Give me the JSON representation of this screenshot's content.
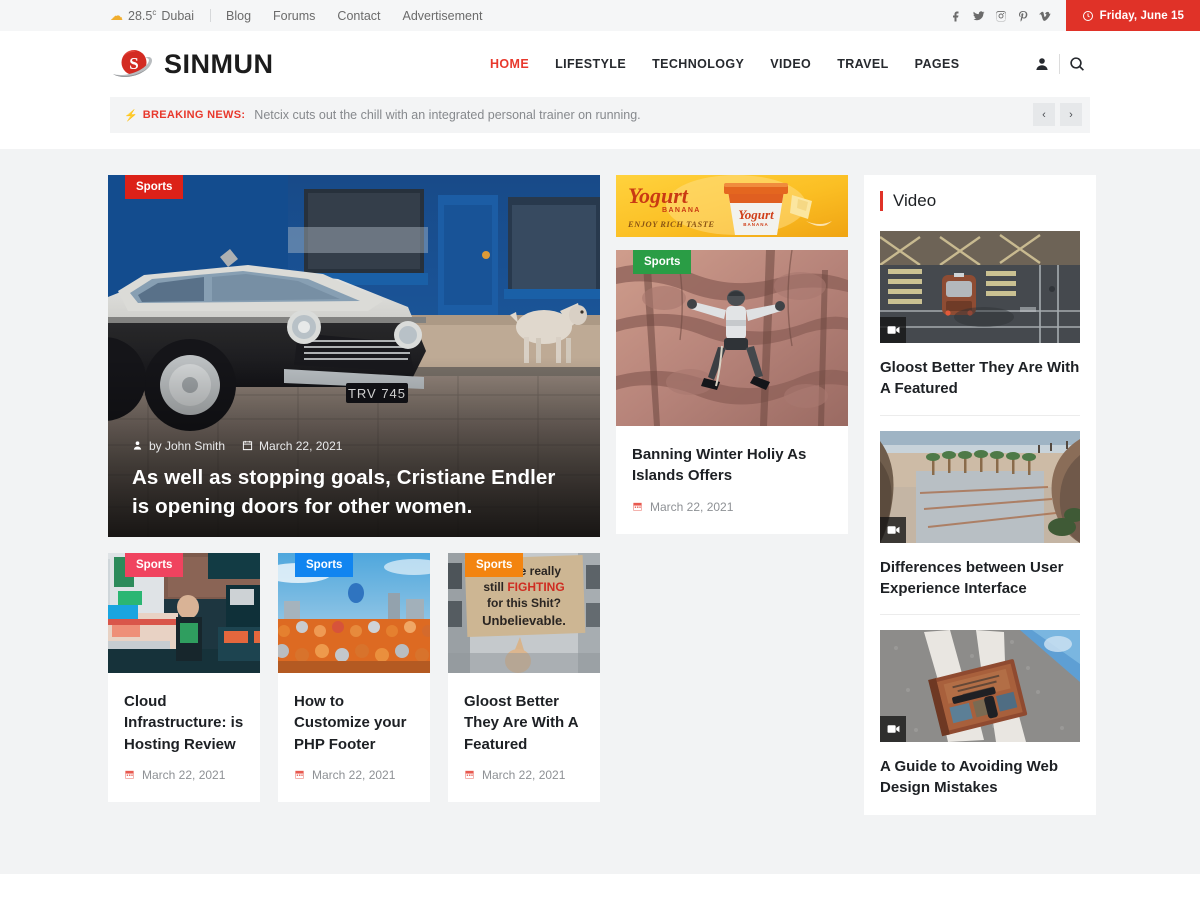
{
  "topbar": {
    "weather_icon": "cloud-sun-icon",
    "weather_temp": "28.5",
    "weather_unit": "c",
    "weather_city": "Dubai",
    "links": [
      "Blog",
      "Forums",
      "Contact",
      "Advertisement"
    ],
    "socials": [
      "facebook-icon",
      "twitter-icon",
      "instagram-icon",
      "pinterest-icon",
      "vimeo-icon"
    ],
    "date": "Friday, June 15",
    "date_bg": "#e03228"
  },
  "header": {
    "logo_text": "SINMUN",
    "nav": [
      {
        "label": "HOME",
        "active": true
      },
      {
        "label": "LIFESTYLE",
        "active": false
      },
      {
        "label": "TECHNOLOGY",
        "active": false
      },
      {
        "label": "VIDEO",
        "active": false
      },
      {
        "label": "TRAVEL",
        "active": false
      },
      {
        "label": "PAGES",
        "active": false
      }
    ],
    "account_icon": "user-icon",
    "search_icon": "search-icon",
    "accent": "#e8382c"
  },
  "breaking": {
    "label": "BREAKING NEWS:",
    "text": "Netcix cuts out the chill with an integrated personal trainer on running.",
    "prev": "‹",
    "next": "›"
  },
  "hero": {
    "badge": "Sports",
    "badge_color": "#dc2118",
    "author": "by John Smith",
    "date": "March 22, 2021",
    "title": "As well as stopping goals, Cristiane Endler is opening doors for other women."
  },
  "cards": [
    {
      "badge": "Sports",
      "badge_class": "pink",
      "title": "Cloud Infrastructure: is Hosting Review",
      "date": "March 22, 2021"
    },
    {
      "badge": "Sports",
      "badge_class": "blue",
      "title": "How to Customize your PHP Footer",
      "date": "March 22, 2021"
    },
    {
      "badge": "Sports",
      "badge_class": "orange",
      "title": "Gloost Better They Are With A Featured",
      "date": "March 22, 2021"
    }
  ],
  "ad": {
    "brand": "Yogurt",
    "flavor": "BANANA",
    "tagline": "ENJOY RICH TASTE",
    "cup_label": "Yogurt"
  },
  "mid_article": {
    "badge": "Sports",
    "badge_class": "green",
    "title": "Banning Winter Holiy As Islands Offers",
    "date": "March 22, 2021"
  },
  "video_widget": {
    "title": "Video",
    "accent": "#e03228",
    "items": [
      {
        "title": "Gloost Better They Are With A Featured",
        "icon": "video-camera-icon"
      },
      {
        "title": "Differences between User Experience Interface",
        "icon": "video-camera-icon"
      },
      {
        "title": "A Guide to Avoiding Web Design Mistakes",
        "icon": "video-camera-icon"
      }
    ]
  }
}
